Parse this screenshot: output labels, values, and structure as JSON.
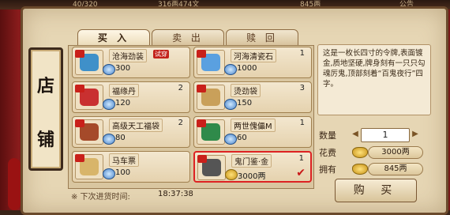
{
  "topbar": {
    "a": "40/320",
    "b": "316两474文",
    "c": "845两",
    "d": "公告"
  },
  "sign": {
    "char1": "店",
    "char2": "铺"
  },
  "tabs": [
    {
      "label": "买 入",
      "active": true
    },
    {
      "label": "卖 出",
      "active": false
    },
    {
      "label": "赎 回",
      "active": false
    }
  ],
  "items": [
    {
      "name": "沧海劲装",
      "badge": "试穿",
      "count": "",
      "price": "300",
      "currency": "blue",
      "color": "#3f90c9"
    },
    {
      "name": "河海清瓷石",
      "badge": "",
      "count": "1",
      "price": "1000",
      "currency": "blue",
      "color": "#5aa0e0"
    },
    {
      "name": "福缘丹",
      "badge": "",
      "count": "2",
      "price": "120",
      "currency": "blue",
      "color": "#c93030"
    },
    {
      "name": "烫劲袋",
      "badge": "",
      "count": "3",
      "price": "150",
      "currency": "blue",
      "color": "#c9a05a"
    },
    {
      "name": "高级天工福袋",
      "badge": "",
      "count": "2",
      "price": "80",
      "currency": "blue",
      "color": "#a54a2a"
    },
    {
      "name": "两世傀儡M",
      "badge": "",
      "count": "1",
      "price": "60",
      "currency": "blue",
      "color": "#2f8a4a"
    },
    {
      "name": "马车票",
      "badge": "",
      "count": "",
      "price": "100",
      "currency": "blue",
      "color": "#d8b56a"
    },
    {
      "name": "鬼门鉴·金",
      "badge": "",
      "count": "1",
      "price": "3000两",
      "currency": "gold",
      "color": "#555555",
      "selected": true
    }
  ],
  "footer": {
    "label": "※ 下次进货时间:",
    "time": "18:37:38"
  },
  "description": "这是一枚长四寸的令牌,表面镀金,质地坚硬,牌身刻有一只只勾魂厉鬼,顶部刻着“百鬼夜行”四字。",
  "purchase": {
    "qty_label": "数量",
    "qty_value": "1",
    "cost_label": "花费",
    "cost_value": "3000两",
    "own_label": "拥有",
    "own_value": "845两",
    "buy_label": "购 买"
  }
}
